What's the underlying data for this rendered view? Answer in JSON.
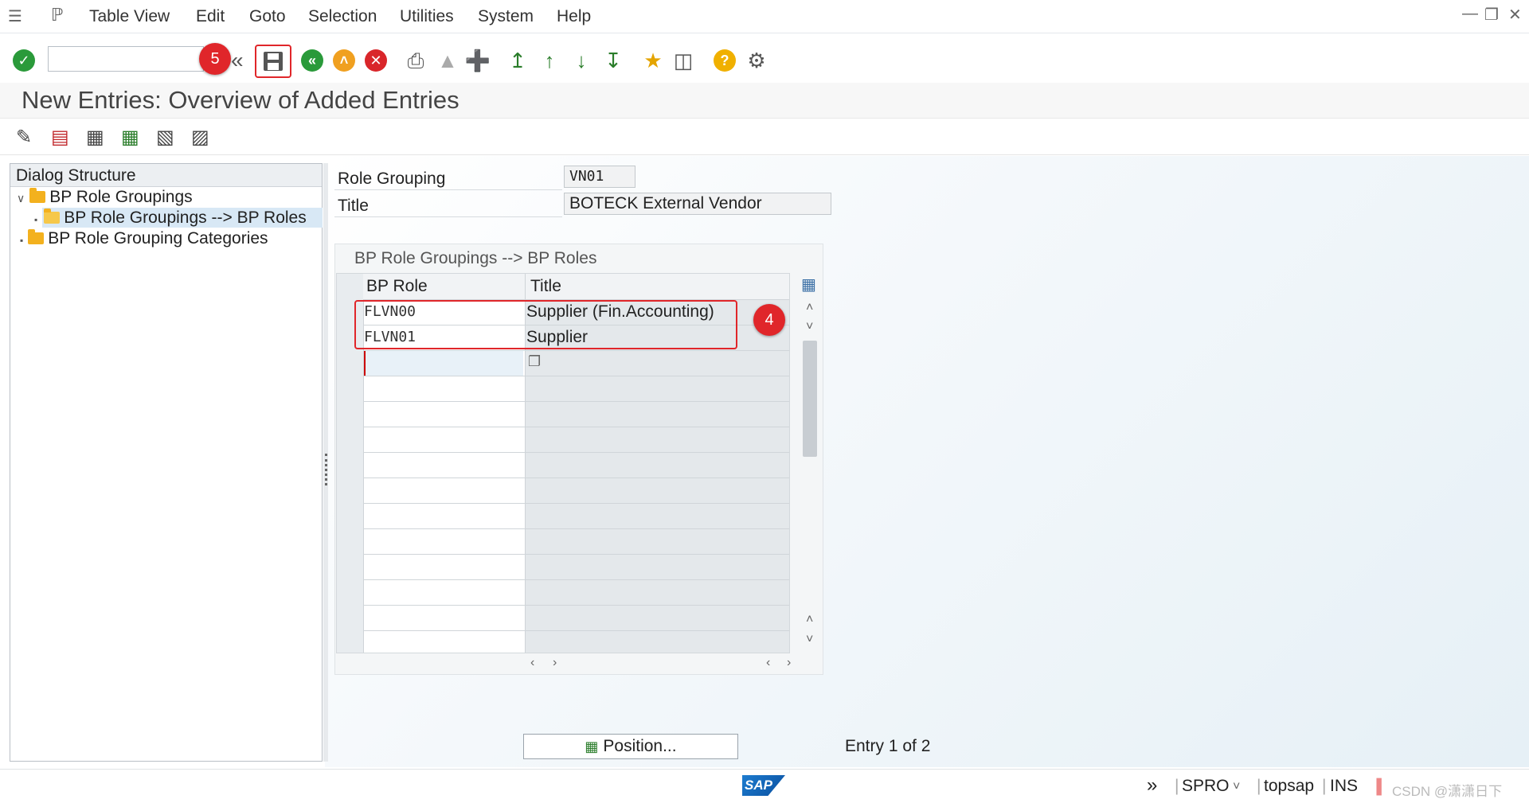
{
  "menu": {
    "items": [
      "Table View",
      "Edit",
      "Goto",
      "Selection",
      "Utilities",
      "System",
      "Help"
    ]
  },
  "toolbar": {
    "command_value": "",
    "badge_save": "5"
  },
  "page": {
    "title": "New Entries: Overview of Added Entries"
  },
  "dialog_structure": {
    "heading": "Dialog Structure",
    "items": [
      {
        "label": "BP Role Groupings",
        "level": 0,
        "expanded": true
      },
      {
        "label": "BP Role Groupings --> BP Roles",
        "level": 1,
        "selected": true
      },
      {
        "label": "BP Role Grouping Categories",
        "level": 0
      }
    ]
  },
  "header": {
    "role_grouping_label": "Role Grouping",
    "role_grouping_value": "VN01",
    "title_label": "Title",
    "title_value": "BOTECK External Vendor"
  },
  "table": {
    "title": "BP Role Groupings --> BP Roles",
    "columns": [
      "BP Role",
      "Title"
    ],
    "rows": [
      {
        "role": "FLVN00",
        "title": "Supplier (Fin.Accounting)"
      },
      {
        "role": "FLVN01",
        "title": "Supplier"
      }
    ],
    "badge_rows": "4"
  },
  "footer": {
    "position_button": "Position...",
    "entry_info": "Entry 1 of 2"
  },
  "status": {
    "transaction": "SPRO",
    "server": "topsap",
    "mode": "INS",
    "watermark": "CSDN @潇潇日下"
  },
  "colors": {
    "badge": "#e0262a",
    "highlight_border": "#e0262a",
    "folder": "#f3b11e",
    "selected_row": "#d8e8f5"
  }
}
